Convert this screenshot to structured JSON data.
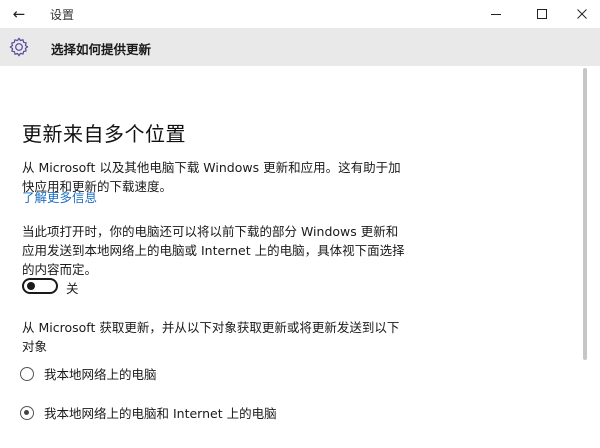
{
  "window": {
    "app_title": "设置",
    "back_icon": "arrow-left-icon",
    "controls": [
      "minimize-icon",
      "maximize-icon",
      "close-icon"
    ]
  },
  "header": {
    "icon": "gear-icon",
    "title": "选择如何提供更新"
  },
  "main": {
    "heading": "更新来自多个位置",
    "intro": "从 Microsoft 以及其他电脑下载 Windows 更新和应用。这有助于加快应用和更新的下载速度。",
    "learn_more": "了解更多信息",
    "description": "当此项打开时，你的电脑还可以将以前下载的部分 Windows 更新和应用发送到本地网络上的电脑或 Internet 上的电脑，具体视下面选择的内容而定。",
    "toggle": {
      "state": "off",
      "label": "关"
    },
    "source_prompt": "从 Microsoft 获取更新，并从以下对象获取更新或将更新发送到以下对象",
    "options": [
      {
        "label": "我本地网络上的电脑",
        "selected": false
      },
      {
        "label": "我本地网络上的电脑和 Internet 上的电脑",
        "selected": true
      }
    ]
  }
}
